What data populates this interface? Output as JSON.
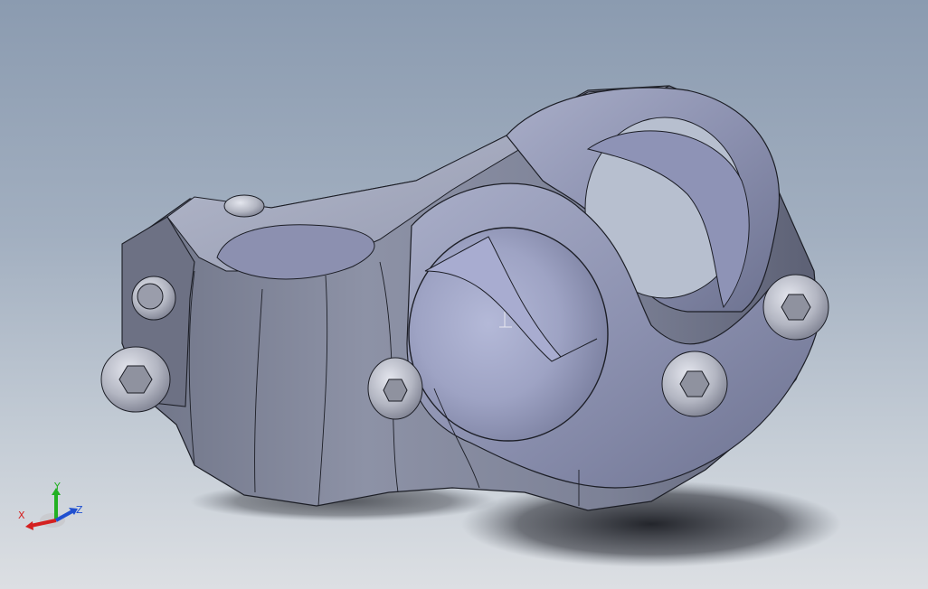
{
  "viewport": {
    "background_top": "#8b9bb0",
    "background_bottom": "#dcdfe3",
    "model_color": "#8a8fa8"
  },
  "triad": {
    "x_label": "X",
    "y_label": "Y",
    "z_label": "Z",
    "x_color": "#d42020",
    "y_color": "#22b022",
    "z_color": "#2050d0"
  },
  "icons": {
    "triad": "reference-triad-icon",
    "origin": "origin-marker-icon"
  }
}
